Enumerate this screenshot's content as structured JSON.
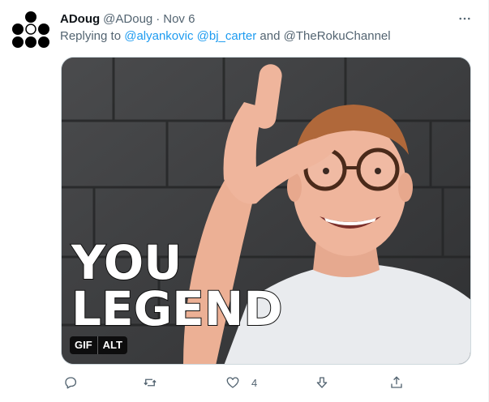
{
  "tweet": {
    "author_name": "ADoug",
    "handle": "@ADoug",
    "separator": "·",
    "time": "Nov 6",
    "reply": {
      "prefix": "Replying to",
      "mentions": [
        "@alyankovic",
        "@bj_carter"
      ],
      "conjunction": "and",
      "last_mention": "@TheRokuChannel"
    },
    "media": {
      "caption_line1": "YOU",
      "caption_line2": "LEGEND",
      "badges": [
        "GIF",
        "ALT"
      ]
    },
    "actions": {
      "like_count": "4"
    }
  },
  "colors": {
    "text": "#0f1419",
    "secondary": "#536471",
    "link": "#1d9bf0",
    "border": "#cfd9de"
  },
  "icons": [
    "more-icon",
    "reply-icon",
    "retweet-icon",
    "like-icon",
    "downvote-icon",
    "share-icon"
  ]
}
